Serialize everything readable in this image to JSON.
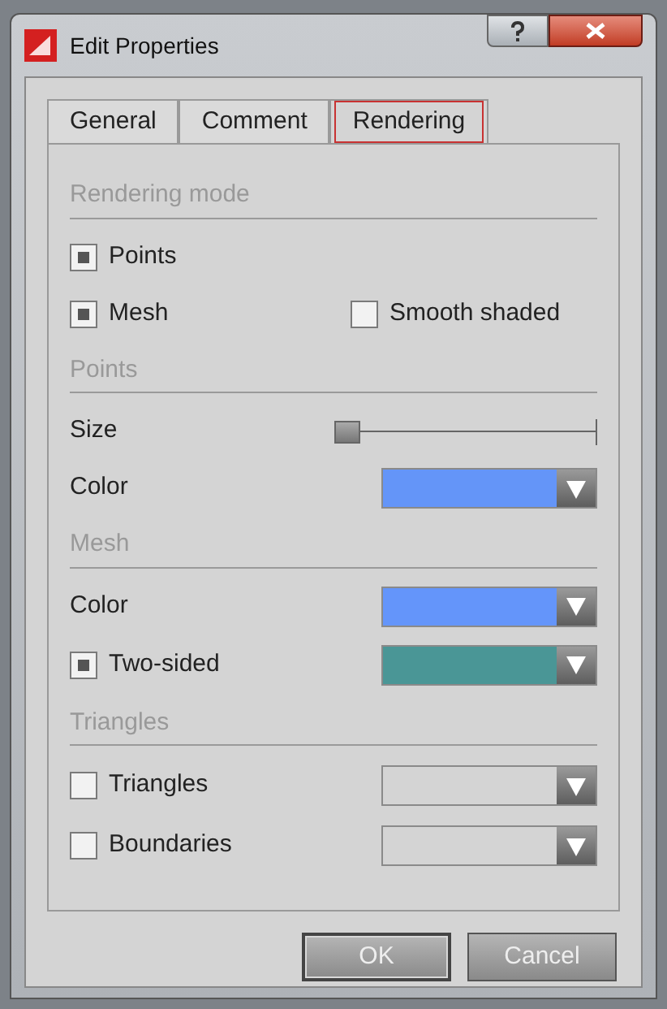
{
  "window": {
    "title": "Edit Properties"
  },
  "tabs": [
    {
      "label": "General",
      "selected": false
    },
    {
      "label": "Comment",
      "selected": false
    },
    {
      "label": "Rendering",
      "selected": true
    }
  ],
  "sections": [
    {
      "title": "Rendering mode",
      "rows": [
        {
          "kind": "checkbox",
          "label": "Points",
          "checked": true
        },
        {
          "kind": "checkbox-pair",
          "label": "Mesh",
          "checked": true,
          "second": {
            "label": "Smooth shaded",
            "checked": false
          }
        }
      ]
    },
    {
      "title": "Points",
      "rows": [
        {
          "kind": "slider",
          "label": "Size",
          "level": 0
        },
        {
          "kind": "color",
          "label": "Color",
          "color": "#6495f8"
        }
      ]
    },
    {
      "title": "Mesh",
      "rows": [
        {
          "kind": "color",
          "label": "Color",
          "color": "#6495fa"
        },
        {
          "kind": "checkbox-color",
          "label": "Two-sided",
          "checked": true,
          "color": "#4a9696"
        }
      ]
    },
    {
      "title": "Triangles",
      "rows": [
        {
          "kind": "checkbox-color",
          "label": "Triangles",
          "checked": false
        },
        {
          "kind": "checkbox-color",
          "label": "Boundaries",
          "checked": false
        }
      ]
    }
  ],
  "buttons": [
    {
      "label": "OK",
      "default": true
    },
    {
      "label": "Cancel",
      "default": false
    }
  ]
}
